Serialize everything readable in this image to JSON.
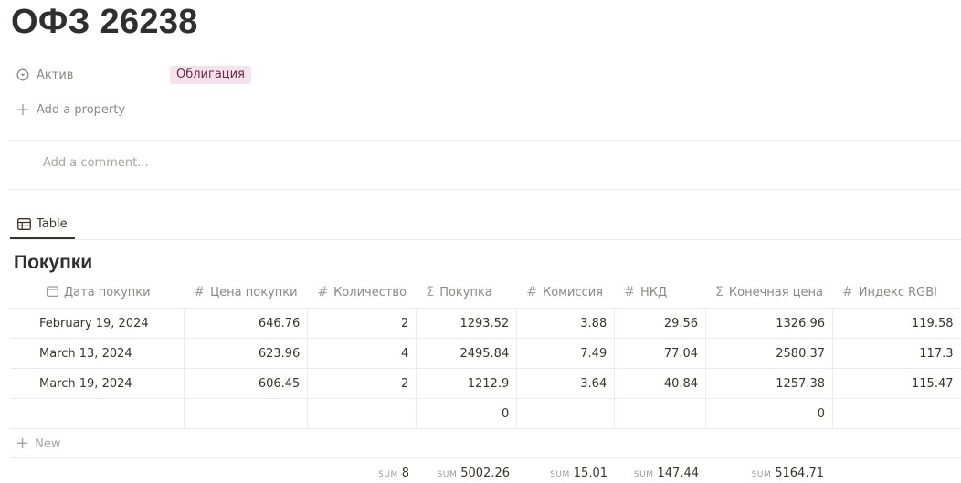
{
  "page": {
    "title": "ОФЗ 26238"
  },
  "properties": {
    "aktiv_label": "Актив",
    "aktiv_value": "Облигация",
    "add_property": "Add a property"
  },
  "comment": {
    "placeholder": "Add a comment..."
  },
  "tabs": [
    {
      "label": "Table"
    }
  ],
  "table": {
    "title": "Покупки",
    "columns": [
      {
        "label": "Дата покупки",
        "icon": "calendar-icon"
      },
      {
        "label": "Цена покупки",
        "icon": "#"
      },
      {
        "label": "Количество",
        "icon": "#"
      },
      {
        "label": "Покупка",
        "icon": "Σ"
      },
      {
        "label": "Комиссия",
        "icon": "#"
      },
      {
        "label": "НКД",
        "icon": "#"
      },
      {
        "label": "Конечная цена",
        "icon": "Σ"
      },
      {
        "label": "Индекс RGBI",
        "icon": "#"
      }
    ],
    "rows": [
      [
        "February 19, 2024",
        "646.76",
        "2",
        "1293.52",
        "3.88",
        "29.56",
        "1326.96",
        "119.58"
      ],
      [
        "March 13, 2024",
        "623.96",
        "4",
        "2495.84",
        "7.49",
        "77.04",
        "2580.37",
        "117.3"
      ],
      [
        "March 19, 2024",
        "606.45",
        "2",
        "1212.9",
        "3.64",
        "40.84",
        "1257.38",
        "115.47"
      ],
      [
        "",
        "",
        "",
        "0",
        "",
        "",
        "0",
        ""
      ]
    ],
    "new_label": "New",
    "sum_label": "SUM",
    "sums": {
      "kolichestvo": "8",
      "pokupka": "5002.26",
      "komissiya": "15.01",
      "nkd": "147.44",
      "konechnaya": "5164.71"
    }
  }
}
